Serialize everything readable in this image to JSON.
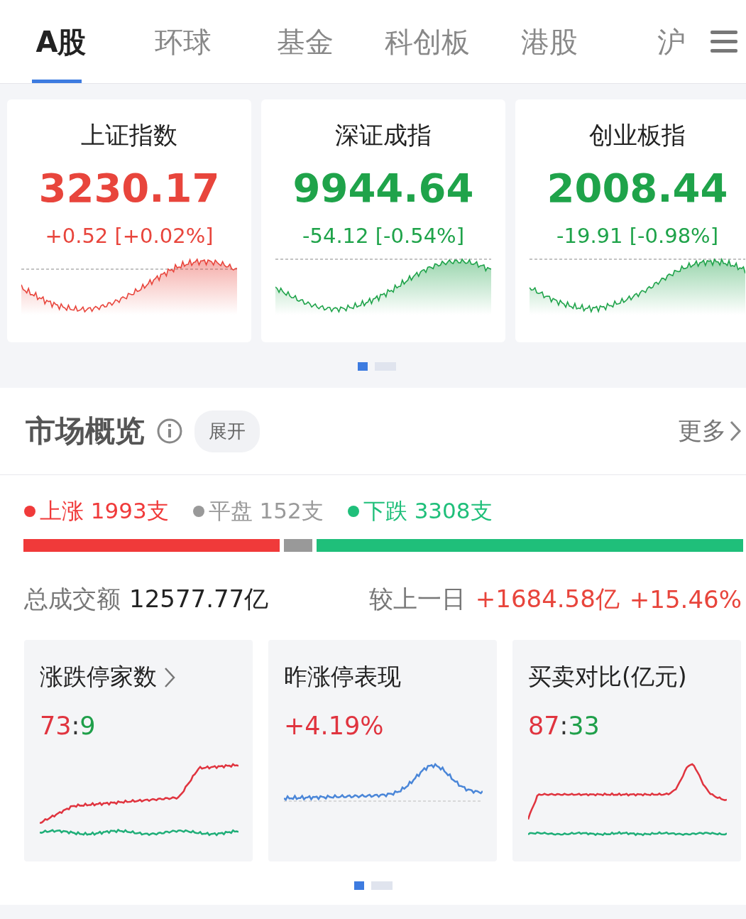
{
  "tabs": [
    {
      "label": "A股",
      "selected": true
    },
    {
      "label": "环球",
      "selected": false
    },
    {
      "label": "基金",
      "selected": false
    },
    {
      "label": "科创板",
      "selected": false
    },
    {
      "label": "港股",
      "selected": false
    },
    {
      "label": "沪",
      "selected": false
    }
  ],
  "indices": [
    {
      "name": "上证指数",
      "value": "3230.17",
      "change": "+0.52 [+0.02%]",
      "color": "#e8453c"
    },
    {
      "name": "深证成指",
      "value": "9944.64",
      "change": "-54.12 [-0.54%]",
      "color": "#1fa34a"
    },
    {
      "name": "创业板指",
      "value": "2008.44",
      "change": "-19.91 [-0.98%]",
      "color": "#1fa34a"
    }
  ],
  "index_pages": [
    {
      "selected": true
    },
    {
      "selected": false
    }
  ],
  "overview": {
    "title": "市场概览",
    "expand_button": "展开",
    "more_link": "更多",
    "breadth": [
      {
        "label": "上涨 1993支",
        "color": "#f03a3a"
      },
      {
        "label": "平盘 152支",
        "color": "#999999"
      },
      {
        "label": "下跌 3308支",
        "color": "#1fbf7a"
      }
    ],
    "turnover_label": "总成交额",
    "turnover_value": "12577.77亿",
    "compare_label": "较上一日",
    "compare_amount": "+1684.58亿",
    "compare_percent": "+15.46%",
    "cards": [
      {
        "title": "涨跌停家数",
        "has_arrow": true,
        "parts": [
          {
            "text": "73",
            "color": "#e0343f"
          },
          {
            "text": ":",
            "color": "#333333"
          },
          {
            "text": "9",
            "color": "#1f9f4a"
          }
        ]
      },
      {
        "title": "昨涨停表现",
        "has_arrow": false,
        "parts": [
          {
            "text": "+4.19%",
            "color": "#e0343f"
          }
        ]
      },
      {
        "title": "买卖对比(亿元)",
        "has_arrow": false,
        "parts": [
          {
            "text": "87",
            "color": "#e0343f"
          },
          {
            "text": ":",
            "color": "#333333"
          },
          {
            "text": "33",
            "color": "#1f9f4a"
          }
        ]
      }
    ],
    "card_pages": [
      {
        "selected": true
      },
      {
        "selected": false
      }
    ]
  }
}
